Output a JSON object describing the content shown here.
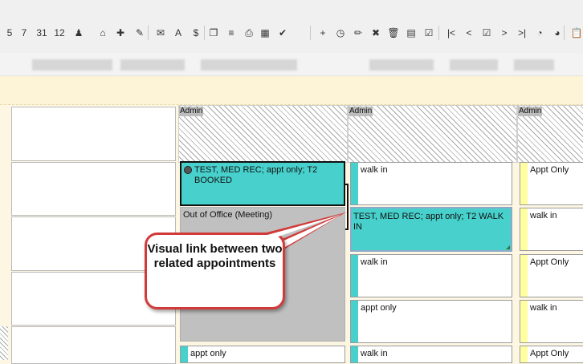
{
  "toolbar": {
    "icons": [
      {
        "name": "calendar-5-icon",
        "glyph": "5"
      },
      {
        "name": "calendar-7-icon",
        "glyph": "7"
      },
      {
        "name": "calendar-31-icon",
        "glyph": "31"
      },
      {
        "name": "calendar-12-icon",
        "glyph": "12"
      },
      {
        "name": "user-dropdown-icon",
        "glyph": "♟"
      },
      {
        "name": "home-icon",
        "glyph": "⌂"
      },
      {
        "name": "hospital-icon",
        "glyph": "✚"
      },
      {
        "name": "edit-schedule-icon",
        "glyph": "✎"
      },
      {
        "name": "mail-icon",
        "glyph": "✉"
      },
      {
        "name": "document-a-icon",
        "glyph": "A"
      },
      {
        "name": "document-s-icon",
        "glyph": "$"
      },
      {
        "name": "copy-icon",
        "glyph": "❐"
      },
      {
        "name": "notes-icon",
        "glyph": "≡"
      },
      {
        "name": "print-icon",
        "glyph": "⎙"
      },
      {
        "name": "grid-icon",
        "glyph": "▦"
      },
      {
        "name": "check-clock-icon",
        "glyph": "✔"
      },
      {
        "name": "add-clock-icon",
        "glyph": "+"
      },
      {
        "name": "clock-icon",
        "glyph": "◷"
      },
      {
        "name": "pencil-icon",
        "glyph": "✏"
      },
      {
        "name": "delete-clock-icon",
        "glyph": "✖"
      },
      {
        "name": "trash-icon",
        "glyph": "🗑"
      },
      {
        "name": "calendar-clock-icon",
        "glyph": "▤"
      },
      {
        "name": "checklist-icon",
        "glyph": "☑"
      },
      {
        "name": "first-icon",
        "glyph": "|<"
      },
      {
        "name": "prev-icon",
        "glyph": "<"
      },
      {
        "name": "today-icon",
        "glyph": "☑"
      },
      {
        "name": "next-icon",
        "glyph": ">"
      },
      {
        "name": "last-icon",
        "glyph": ">|"
      },
      {
        "name": "clock-arrow-icon",
        "glyph": "◔"
      },
      {
        "name": "clock-gear-icon",
        "glyph": "◕"
      },
      {
        "name": "clipboard-icon",
        "glyph": "📋"
      }
    ]
  },
  "columns": [
    {
      "header": "Admin"
    },
    {
      "header": "Admin"
    },
    {
      "header": "Admin"
    }
  ],
  "col1": {
    "booked_text": "TEST, MED REC; appt only; T2 BOOKED",
    "out_of_office": "Out of Office (Meeting)",
    "appt_only": "appt only"
  },
  "col2": {
    "slots": [
      "walk in",
      "TEST, MED REC; appt only; T2 WALK IN",
      "walk in",
      "appt only",
      "walk in"
    ]
  },
  "col3": {
    "slots": [
      "Appt Only",
      "walk in",
      "Appt Only",
      "walk in",
      "Appt Only"
    ]
  },
  "callout": {
    "text": "Visual link between two related appointments"
  },
  "colors": {
    "teal": "#48d1cc",
    "yellow": "#ffffa0",
    "callout_border": "#d23a3a",
    "out_of_office": "#c0c0c0"
  }
}
